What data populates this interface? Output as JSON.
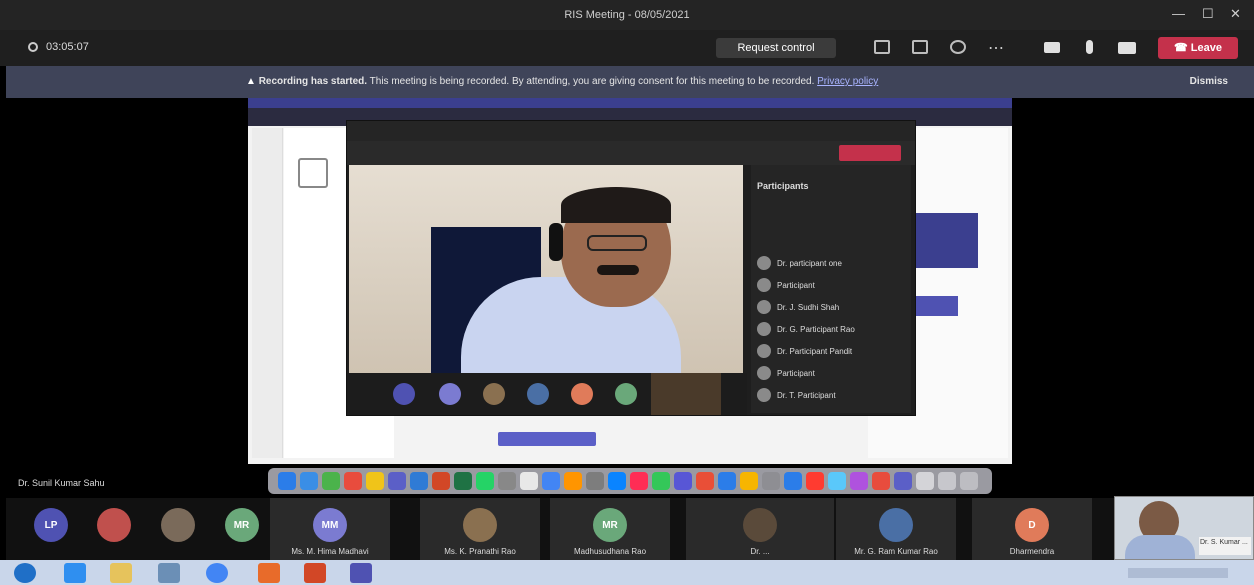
{
  "window": {
    "title": "RIS Meeting - 08/05/2021",
    "minimize": "—",
    "restore": "☐",
    "close": "✕"
  },
  "toolbar": {
    "timer": "03:05:07",
    "request_control": "Request control",
    "leave": "Leave",
    "icons": [
      "share-icon",
      "whiteboard-icon",
      "participants-icon",
      "more-icon",
      "camera-icon",
      "mic-icon",
      "screen-share-icon"
    ]
  },
  "banner": {
    "bold": "Recording has started.",
    "text": "This meeting is being recorded. By attending, you are giving consent for this meeting to be recorded.",
    "link": "Privacy policy",
    "dismiss": "Dismiss"
  },
  "shared_screen": {
    "participants_title": "Participants",
    "participants": [
      "Dr. participant one",
      "Participant",
      "Dr. J. Sudhi Shah",
      "Dr. G. Participant Rao",
      "Dr. Participant Pandit",
      "Participant",
      "Dr. T. Participant"
    ]
  },
  "presenter_name": "Dr. Sunil Kumar Sahu",
  "gallery": [
    {
      "initials": "LP",
      "name": "",
      "color": "#4f52b2"
    },
    {
      "initials": "",
      "name": "",
      "color": "#c0504d"
    },
    {
      "initials": "",
      "name": "",
      "color": "#7a6a5a"
    },
    {
      "initials": "MR",
      "name": "",
      "color": "#6aa87a"
    },
    {
      "initials": "MM",
      "name": "Ms. M. Hima Madhavi",
      "color": "#7b7bd1"
    },
    {
      "initials": "",
      "name": "Ms. K. Pranathi Rao",
      "color": "#8a7050"
    },
    {
      "initials": "MR",
      "name": "Madhusudhana Rao",
      "color": "#6aa87a"
    },
    {
      "initials": "",
      "name": "Dr. ...",
      "color": "#5a4a3a"
    },
    {
      "initials": "",
      "name": "Mr. G. Ram Kumar Rao",
      "color": "#4a6fa5"
    },
    {
      "initials": "D",
      "name": "Dharmendra",
      "color": "#e07b5a"
    }
  ],
  "selfview": {
    "label": "Dr. S. Kumar ..."
  },
  "colors": {
    "leave": "#c4314b",
    "banner": "#3f4459",
    "teams": "#4f52b2"
  }
}
